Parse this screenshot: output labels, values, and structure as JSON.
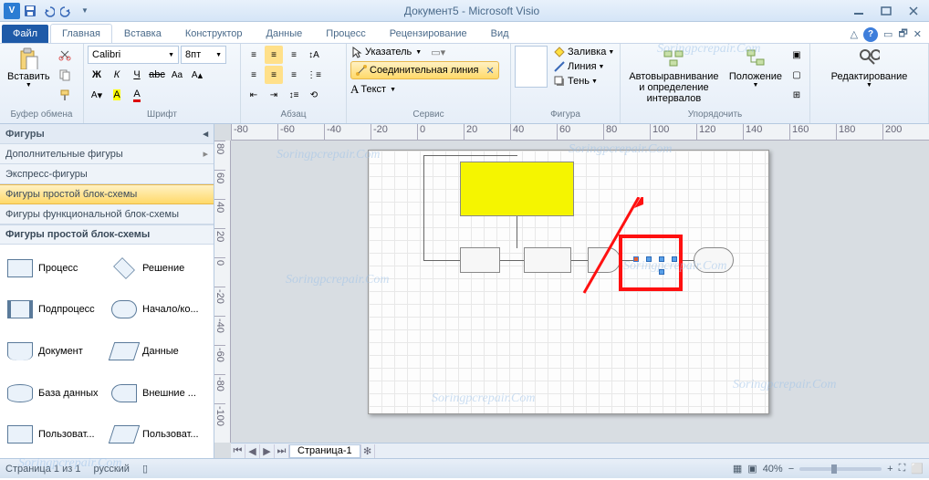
{
  "app": {
    "title": "Документ5 - Microsoft Visio"
  },
  "tabs": {
    "file": "Файл",
    "items": [
      "Главная",
      "Вставка",
      "Конструктор",
      "Данные",
      "Процесс",
      "Рецензирование",
      "Вид"
    ],
    "active": 0
  },
  "ribbon": {
    "clipboard": {
      "paste": "Вставить",
      "label": "Буфер обмена"
    },
    "font": {
      "name": "Calibri",
      "size": "8пт",
      "label": "Шрифт"
    },
    "paragraph": {
      "label": "Абзац"
    },
    "tools": {
      "pointer": "Указатель",
      "connector": "Соединительная линия",
      "text": "Текст",
      "label": "Сервис"
    },
    "shape_style": {
      "fill": "Заливка",
      "line": "Линия",
      "shadow": "Тень",
      "label": "Фигура"
    },
    "arrange": {
      "auto": "Автовыравнивание и определение интервалов",
      "position": "Положение",
      "label": "Упорядочить"
    },
    "editing": {
      "label": "Редактирование"
    }
  },
  "shapes_panel": {
    "header": "Фигуры",
    "cats": [
      "Дополнительные фигуры",
      "Экспресс-фигуры",
      "Фигуры простой блок-схемы",
      "Фигуры функциональной блок-схемы"
    ],
    "selected": 2,
    "section_title": "Фигуры простой блок-схемы",
    "items": [
      "Процесс",
      "Решение",
      "Подпроцесс",
      "Начало/ко...",
      "Документ",
      "Данные",
      "База данных",
      "Внешние ...",
      "Пользоват...",
      "Пользоват..."
    ]
  },
  "ruler_h": [
    "-80",
    "-60",
    "-40",
    "-20",
    "0",
    "20",
    "40",
    "60",
    "80",
    "100",
    "120",
    "140",
    "160",
    "180",
    "200"
  ],
  "ruler_v": [
    "80",
    "60",
    "40",
    "20",
    "0",
    "-20",
    "-40",
    "-60",
    "-80",
    "-100"
  ],
  "page_tabs": {
    "page1": "Страница-1"
  },
  "status": {
    "page": "Страница 1 из 1",
    "lang": "русский",
    "zoom": "40%"
  },
  "watermark": "Soringpcrepair.Com"
}
